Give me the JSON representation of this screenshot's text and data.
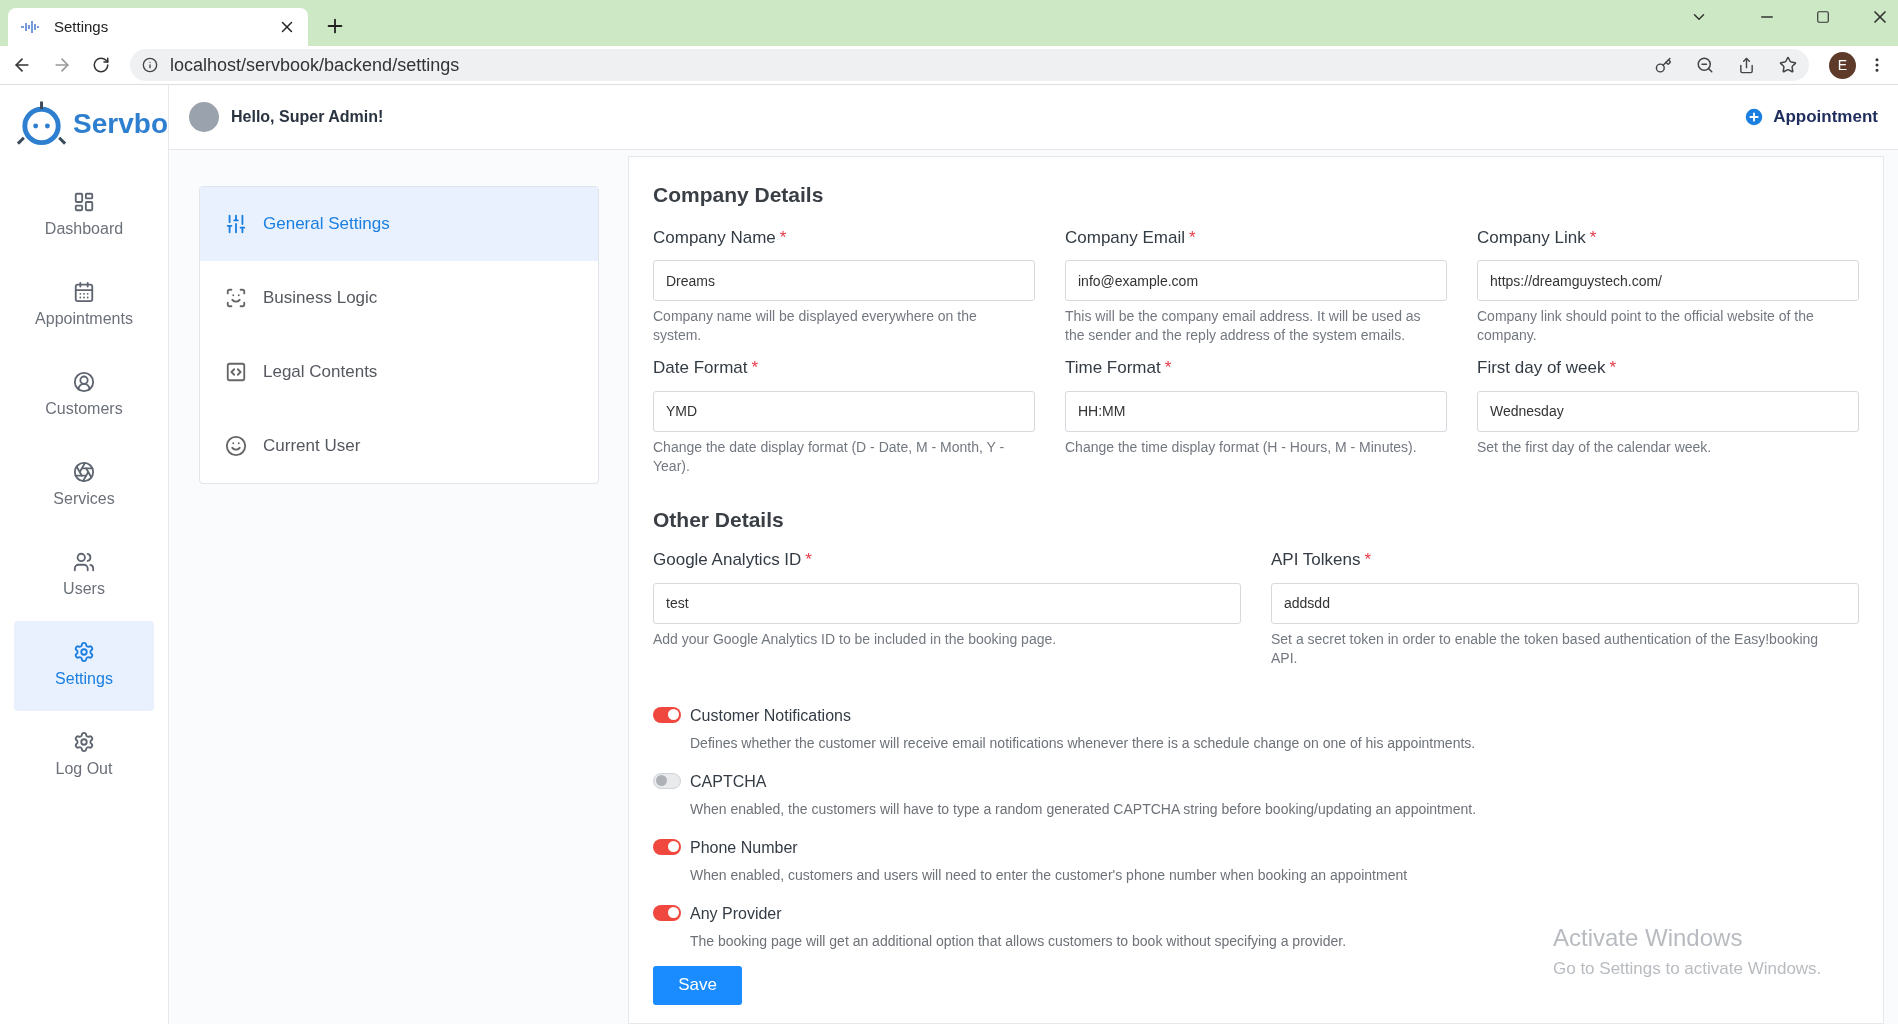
{
  "browser": {
    "tab_title": "Settings",
    "url": "localhost/servbook/backend/settings",
    "profile_initial": "E"
  },
  "header": {
    "logo_text": "Servbo",
    "greeting": "Hello, Super Admin!",
    "appointment_button": "Appointment"
  },
  "sidebar": {
    "items": [
      {
        "label": "Dashboard",
        "selected": false
      },
      {
        "label": "Appointments",
        "selected": false
      },
      {
        "label": "Customers",
        "selected": false
      },
      {
        "label": "Services",
        "selected": false
      },
      {
        "label": "Users",
        "selected": false
      },
      {
        "label": "Settings",
        "selected": true
      },
      {
        "label": "Log Out",
        "selected": false
      }
    ]
  },
  "settings_menu": {
    "items": [
      {
        "label": "General Settings",
        "selected": true
      },
      {
        "label": "Business Logic",
        "selected": false
      },
      {
        "label": "Legal Contents",
        "selected": false
      },
      {
        "label": "Current User",
        "selected": false
      }
    ]
  },
  "company_details": {
    "title": "Company Details",
    "fields": [
      {
        "label": "Company Name",
        "required_mark": "*",
        "value": "Dreams",
        "help": "Company name will be displayed everywhere on the system."
      },
      {
        "label": "Company Email",
        "required_mark": "*",
        "value": "info@example.com",
        "help": "This will be the company email address. It will be used as the sender and the reply address of the system emails."
      },
      {
        "label": "Company Link",
        "required_mark": "*",
        "value": "https://dreamguystech.com/",
        "help": "Company link should point to the official website of the company."
      },
      {
        "label": "Date Format",
        "required_mark": "*",
        "value": "YMD",
        "help": "Change the date display format (D - Date, M - Month, Y - Year)."
      },
      {
        "label": "Time Format",
        "required_mark": "*",
        "value": "HH:MM",
        "help": "Change the time display format (H - Hours, M - Minutes)."
      },
      {
        "label": "First day of week",
        "required_mark": "*",
        "value": "Wednesday",
        "help": "Set the first day of the calendar week."
      }
    ]
  },
  "other_details": {
    "title": "Other Details",
    "fields": [
      {
        "label": "Google Analytics ID",
        "required_mark": "*",
        "value": "test",
        "help": "Add your Google Analytics ID to be included in the booking page."
      },
      {
        "label": "API Tolkens",
        "required_mark": "*",
        "value": "addsdd",
        "help": "Set a secret token in order to enable the token based authentication of the Easy!booking API."
      }
    ]
  },
  "toggles": [
    {
      "label": "Customer Notifications",
      "on": true,
      "description": "Defines whether the customer will receive email notifications whenever there is a schedule change on one of his appointments."
    },
    {
      "label": "CAPTCHA",
      "on": false,
      "description": "When enabled, the customers will have to type a random generated CAPTCHA string before booking/updating an appointment."
    },
    {
      "label": "Phone Number",
      "on": true,
      "description": "When enabled, customers and users will need to enter the customer's phone number when booking an appointment"
    },
    {
      "label": "Any Provider",
      "on": true,
      "description": "The booking page will get an additional option that allows customers to book without specifying a provider."
    }
  ],
  "save_button": "Save",
  "os_notice": {
    "title": "Activate Windows",
    "subtitle": "Go to Settings to activate Windows."
  }
}
